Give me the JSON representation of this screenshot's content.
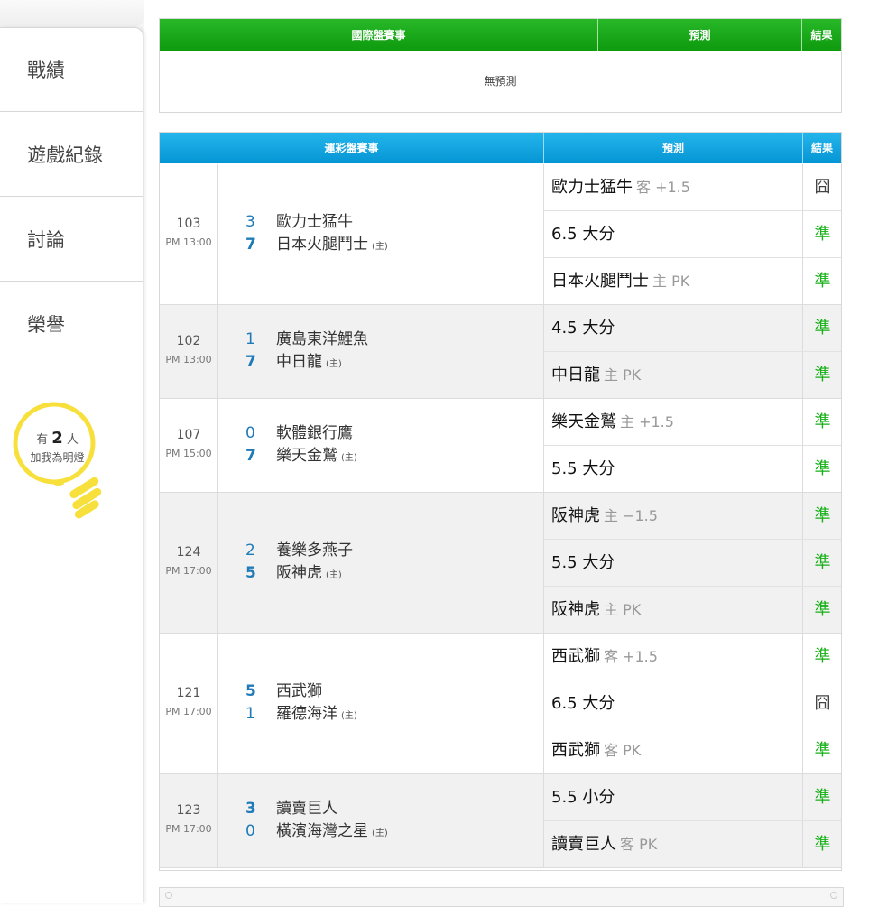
{
  "nav": {
    "items": [
      {
        "label": "戰績"
      },
      {
        "label": "遊戲紀錄"
      },
      {
        "label": "討論"
      },
      {
        "label": "榮譽"
      }
    ]
  },
  "bulb": {
    "prefix": "有",
    "count": "2",
    "suffix": "人",
    "caption": "加我為明燈"
  },
  "intl": {
    "head": {
      "event": "國際盤賽事",
      "prediction": "預測",
      "result": "結果"
    },
    "empty": "無預測"
  },
  "sport": {
    "head": {
      "event": "運彩盤賽事",
      "prediction": "預測",
      "result": "結果"
    },
    "games": [
      {
        "id": "103",
        "time": "PM 13:00",
        "away": {
          "score": "3",
          "name": "歐力士猛牛"
        },
        "home": {
          "score": "7",
          "name": "日本火腿鬥士",
          "tag": "(主)"
        },
        "predictions": [
          {
            "main": "歐力士猛牛",
            "sub": "客 +1.5",
            "result": "囧",
            "status": "lose"
          },
          {
            "main": "6.5 大分",
            "sub": "",
            "result": "準",
            "status": "win"
          },
          {
            "main": "日本火腿鬥士",
            "sub": "主 PK",
            "result": "準",
            "status": "win"
          }
        ]
      },
      {
        "id": "102",
        "time": "PM 13:00",
        "away": {
          "score": "1",
          "name": "廣島東洋鯉魚"
        },
        "home": {
          "score": "7",
          "name": "中日龍",
          "tag": "(主)"
        },
        "predictions": [
          {
            "main": "4.5 大分",
            "sub": "",
            "result": "準",
            "status": "win"
          },
          {
            "main": "中日龍",
            "sub": "主 PK",
            "result": "準",
            "status": "win"
          }
        ]
      },
      {
        "id": "107",
        "time": "PM 15:00",
        "away": {
          "score": "0",
          "name": "軟體銀行鷹"
        },
        "home": {
          "score": "7",
          "name": "樂天金鷲",
          "tag": "(主)"
        },
        "predictions": [
          {
            "main": "樂天金鷲",
            "sub": "主 +1.5",
            "result": "準",
            "status": "win"
          },
          {
            "main": "5.5 大分",
            "sub": "",
            "result": "準",
            "status": "win"
          }
        ]
      },
      {
        "id": "124",
        "time": "PM 17:00",
        "away": {
          "score": "2",
          "name": "養樂多燕子"
        },
        "home": {
          "score": "5",
          "name": "阪神虎",
          "tag": "(主)"
        },
        "predictions": [
          {
            "main": "阪神虎",
            "sub": "主 −1.5",
            "result": "準",
            "status": "win"
          },
          {
            "main": "5.5 大分",
            "sub": "",
            "result": "準",
            "status": "win"
          },
          {
            "main": "阪神虎",
            "sub": "主 PK",
            "result": "準",
            "status": "win"
          }
        ]
      },
      {
        "id": "121",
        "time": "PM 17:00",
        "away": {
          "score": "5",
          "name": "西武獅"
        },
        "home": {
          "score": "1",
          "name": "羅德海洋",
          "tag": "(主)"
        },
        "predictions": [
          {
            "main": "西武獅",
            "sub": "客 +1.5",
            "result": "準",
            "status": "win"
          },
          {
            "main": "6.5 大分",
            "sub": "",
            "result": "囧",
            "status": "lose"
          },
          {
            "main": "西武獅",
            "sub": "客 PK",
            "result": "準",
            "status": "win"
          }
        ]
      },
      {
        "id": "123",
        "time": "PM 17:00",
        "away": {
          "score": "3",
          "name": "讀賣巨人"
        },
        "home": {
          "score": "0",
          "name": "橫濱海灣之星",
          "tag": "(主)"
        },
        "predictions": [
          {
            "main": "5.5 小分",
            "sub": "",
            "result": "準",
            "status": "win"
          },
          {
            "main": "讀賣巨人",
            "sub": "客 PK",
            "result": "準",
            "status": "win"
          }
        ]
      }
    ]
  },
  "colors": {
    "win": "#16b016",
    "lose": "#444444",
    "intl_header": "#0d9a0d",
    "sport_header": "#0495d4",
    "bulb": "#f7e03c"
  }
}
